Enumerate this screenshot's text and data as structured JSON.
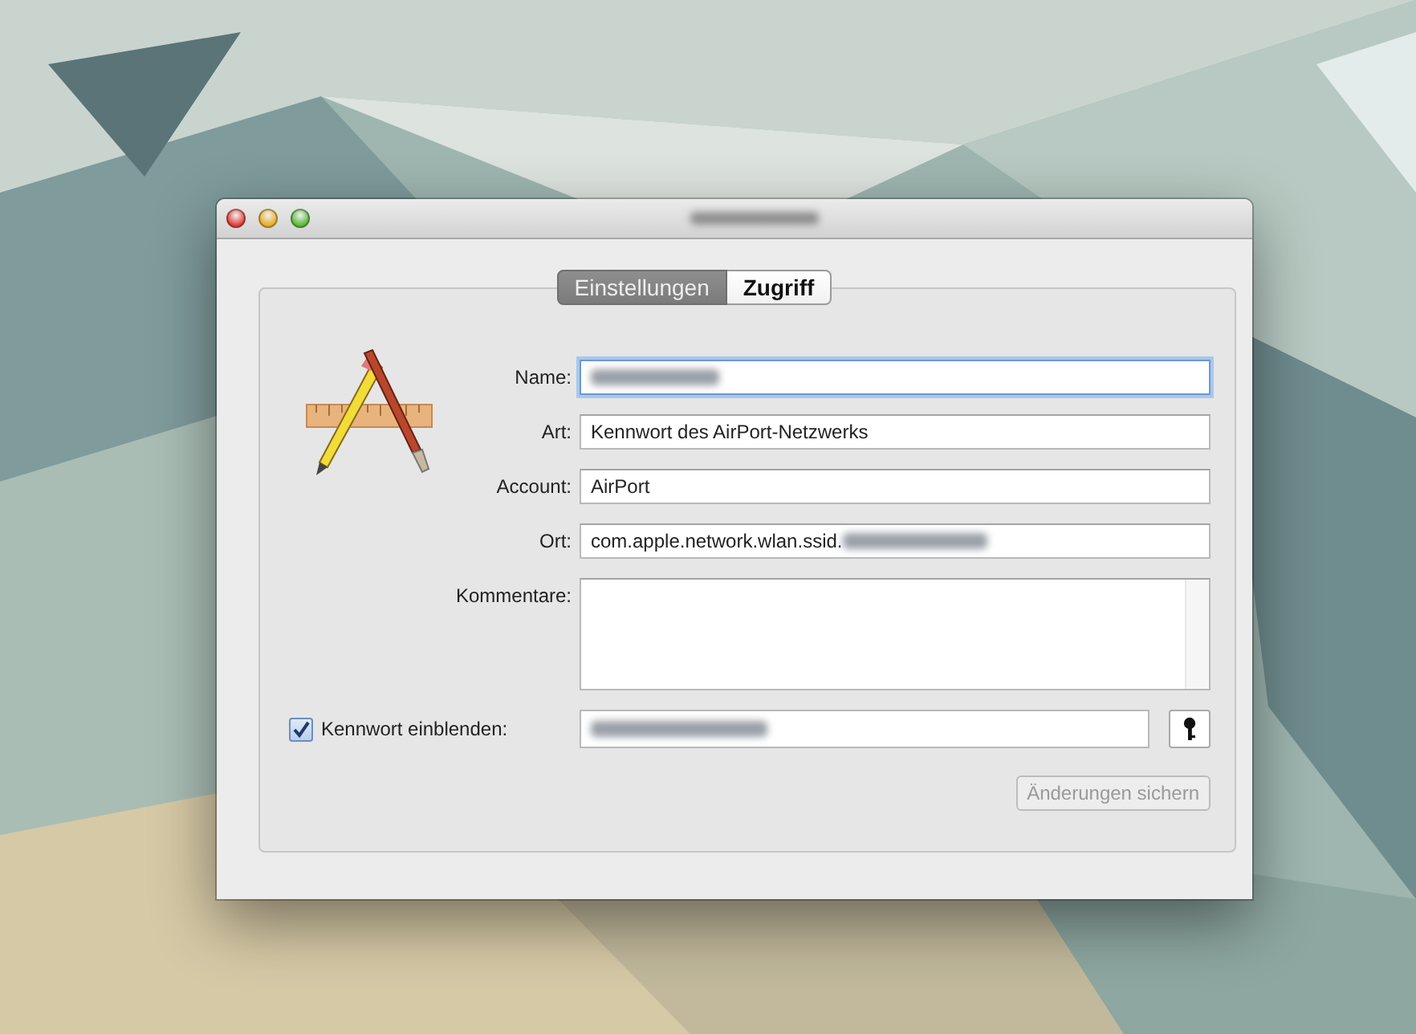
{
  "window": {
    "title_redacted": true
  },
  "tabs": [
    {
      "label": "Einstellungen",
      "selected": true
    },
    {
      "label": "Zugriff",
      "selected": false
    }
  ],
  "fields": [
    {
      "label": "Name:",
      "kind": "text",
      "focused": true,
      "redacted": true
    },
    {
      "label": "Art:",
      "kind": "text",
      "focused": false,
      "value": "Kennwort des AirPort-Netzwerks"
    },
    {
      "label": "Account:",
      "kind": "text",
      "focused": false,
      "value": "AirPort"
    },
    {
      "label": "Ort:",
      "kind": "text",
      "focused": false,
      "value": "com.apple.network.wlan.ssid.",
      "redacted": true
    },
    {
      "label": "Kommentare:",
      "kind": "textarea",
      "focused": false
    }
  ],
  "password": {
    "label": "Kennwort einblenden:",
    "checked": true,
    "redacted": true
  },
  "save_button": {
    "label": "Änderungen sichern",
    "disabled": true
  }
}
